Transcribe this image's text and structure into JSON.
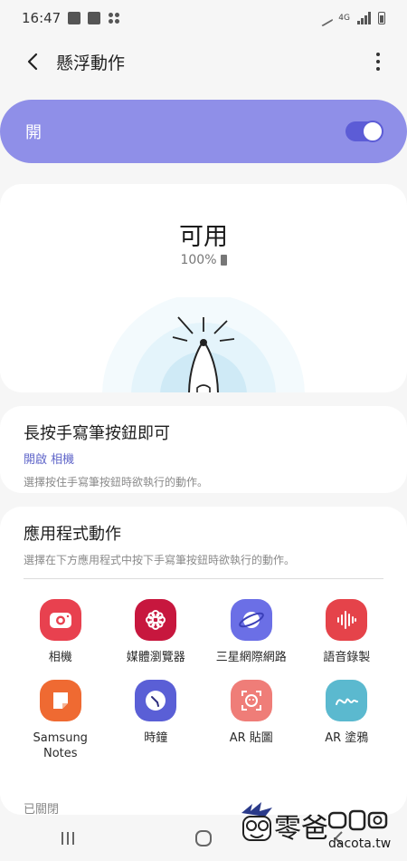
{
  "status_bar": {
    "time": "16:47",
    "network": "4G",
    "icons": [
      "image-icon",
      "sim-icon",
      "dots-icon",
      "pen-icon",
      "signal-icon",
      "battery-icon"
    ]
  },
  "header": {
    "title": "懸浮動作",
    "back_icon": "chevron-left-icon",
    "more_icon": "more-vertical-icon"
  },
  "master_toggle": {
    "label": "開",
    "on": true,
    "color": "#8f8fe8"
  },
  "pen_status": {
    "title": "可用",
    "battery": "100%"
  },
  "press_button": {
    "title": "長按手寫筆按鈕即可",
    "status": "開啟 相機",
    "description": "選擇按住手寫筆按鈕時欲執行的動作。"
  },
  "app_actions": {
    "title": "應用程式動作",
    "description": "選擇在下方應用程式中按下手寫筆按鈕時欲執行的動作。",
    "apps": [
      {
        "label": "相機",
        "icon": "camera-icon",
        "color": "#e8414f"
      },
      {
        "label": "媒體瀏覽器",
        "icon": "gallery-flower-icon",
        "color": "#c7173e"
      },
      {
        "label": "三星網際網路",
        "icon": "internet-planet-icon",
        "color": "#6b6fe6"
      },
      {
        "label": "語音錄製",
        "icon": "voice-recorder-icon",
        "color": "#e5434a"
      },
      {
        "label": "Samsung\nNotes",
        "icon": "notes-icon",
        "color": "#ef6a32"
      },
      {
        "label": "時鐘",
        "icon": "clock-icon",
        "color": "#5a5fd6"
      },
      {
        "label": "AR 貼圖",
        "icon": "ar-emoji-icon",
        "color": "#ef7d78"
      },
      {
        "label": "AR 塗鴉",
        "icon": "ar-doodle-icon",
        "color": "#5bb9cf"
      }
    ],
    "off_section": "已關閉"
  },
  "nav_bar": {
    "items": [
      "recents-icon",
      "home-icon",
      "back-icon"
    ]
  },
  "watermark": {
    "text": "零爸",
    "domain": "dacota.tw"
  }
}
